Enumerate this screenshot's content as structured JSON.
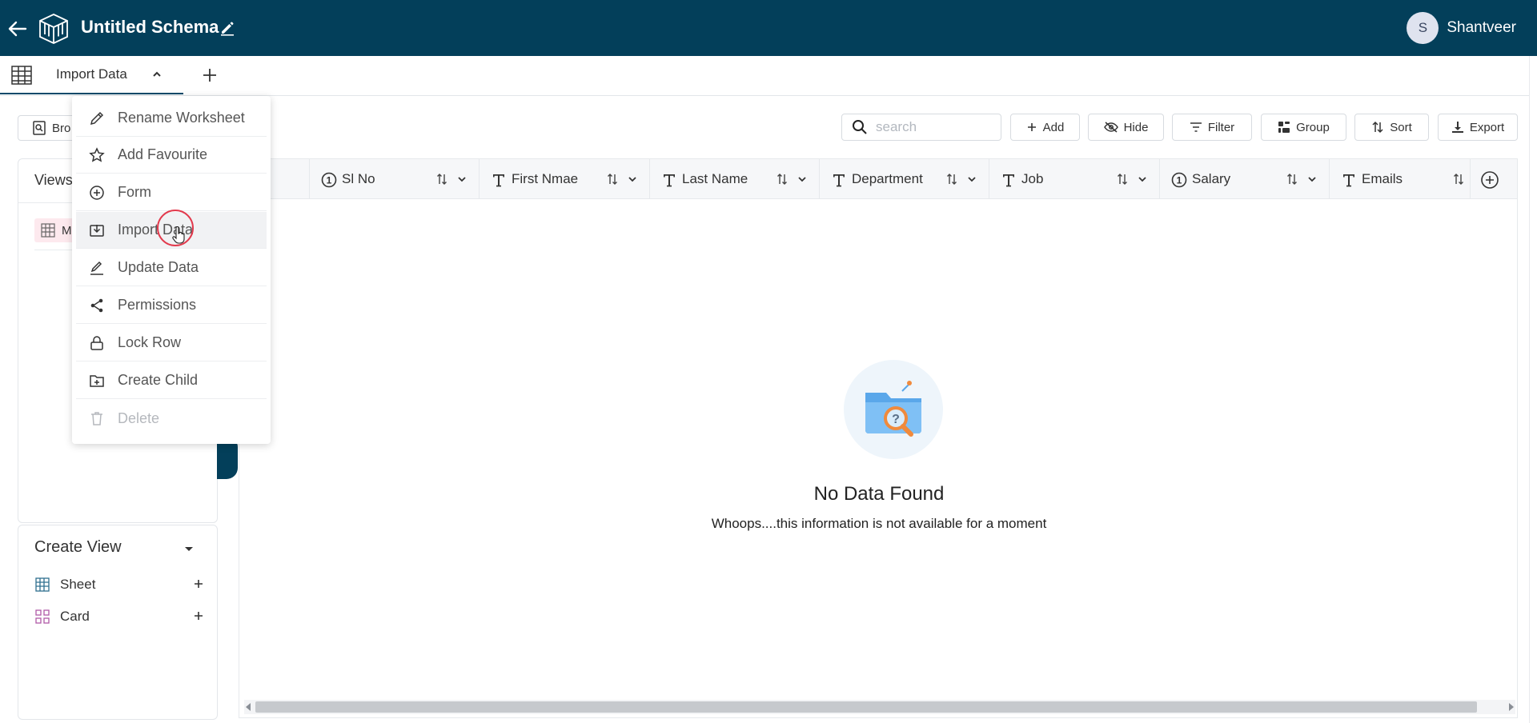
{
  "app": {
    "title": "Untitled Schema"
  },
  "user": {
    "name": "Shantveer",
    "initial": "S"
  },
  "tab": {
    "label": "Import Data"
  },
  "browse": {
    "label": "Bro"
  },
  "sidebar": {
    "views_title": "Views",
    "view_item_label": "M"
  },
  "create_view": {
    "title": "Create View",
    "items": [
      {
        "label": "Sheet"
      },
      {
        "label": "Card"
      }
    ]
  },
  "toolbar": {
    "search_placeholder": "search",
    "add": "Add",
    "hide": "Hide",
    "filter": "Filter",
    "group": "Group",
    "sort": "Sort",
    "export": "Export"
  },
  "columns": [
    {
      "label": "Sl No",
      "type": "number"
    },
    {
      "label": "First Nmae",
      "type": "text"
    },
    {
      "label": "Last Name",
      "type": "text"
    },
    {
      "label": "Department",
      "type": "text"
    },
    {
      "label": "Job",
      "type": "text"
    },
    {
      "label": "Salary",
      "type": "number"
    },
    {
      "label": "Emails",
      "type": "text"
    }
  ],
  "empty": {
    "title": "No Data Found",
    "subtitle": "Whoops....this information is not available for a moment"
  },
  "menu": {
    "items": [
      {
        "label": "Rename Worksheet",
        "icon": "pencil-icon"
      },
      {
        "label": "Add Favourite",
        "icon": "star-icon"
      },
      {
        "label": "Form",
        "icon": "plus-circle-icon"
      },
      {
        "label": "Import Data",
        "icon": "import-icon"
      },
      {
        "label": "Update Data",
        "icon": "edit-line-icon"
      },
      {
        "label": "Permissions",
        "icon": "share-icon"
      },
      {
        "label": "Lock Row",
        "icon": "lock-icon"
      },
      {
        "label": "Create Child",
        "icon": "folder-plus-icon"
      },
      {
        "label": "Delete",
        "icon": "trash-icon"
      }
    ]
  },
  "colors": {
    "topbar": "#033f5a",
    "accent": "#0b4b6b",
    "highlight": "#fde9ee",
    "cursor_ring": "#e23a4d"
  }
}
